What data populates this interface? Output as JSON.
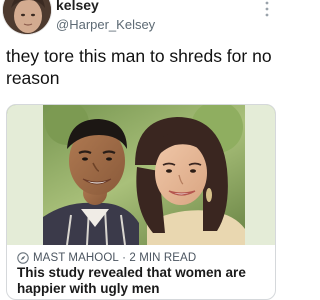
{
  "tweet": {
    "display_name": "kelsey",
    "handle": "@Harper_Kelsey",
    "text": "they tore this man to shreds for no reason"
  },
  "card": {
    "source": "MAST MAHOOL",
    "read_time": "2 MIN READ",
    "meta_separator": " · ",
    "title": "This study revealed that women are happier with ugly men"
  },
  "icons": {
    "more": "vertical-ellipsis-icon",
    "source": "compass-icon"
  },
  "colors": {
    "background": "#ffffff",
    "handle": "#5d6a74",
    "card_border": "#d5d8db"
  }
}
